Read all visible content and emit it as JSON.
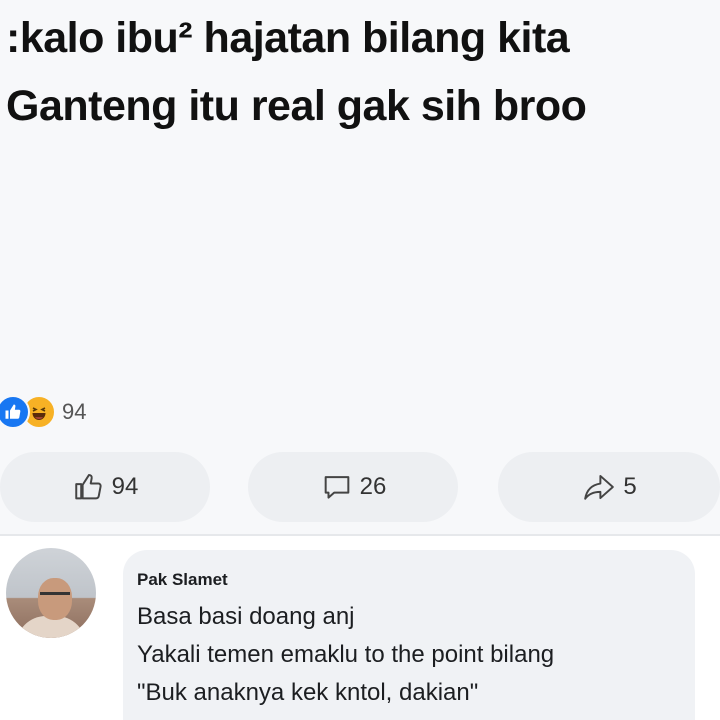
{
  "post": {
    "lines": [
      ":kalo ibu² hajatan bilang kita",
      "Ganteng itu real gak sih broo"
    ]
  },
  "reactions": {
    "icons": [
      "like-icon",
      "haha-icon"
    ],
    "count": "94"
  },
  "actions": {
    "like_count": "94",
    "comment_count": "26",
    "share_count": "5"
  },
  "comment": {
    "author": "Pak Slamet",
    "lines": [
      "Basa basi doang anj",
      "Yakali temen emaklu to the point bilang",
      "\"Buk anaknya kek kntol, dakian\""
    ]
  },
  "colors": {
    "accent": "#1877f2",
    "haha": "#f7b125",
    "background": "#f7f8fa",
    "bubble": "#f0f2f5"
  }
}
